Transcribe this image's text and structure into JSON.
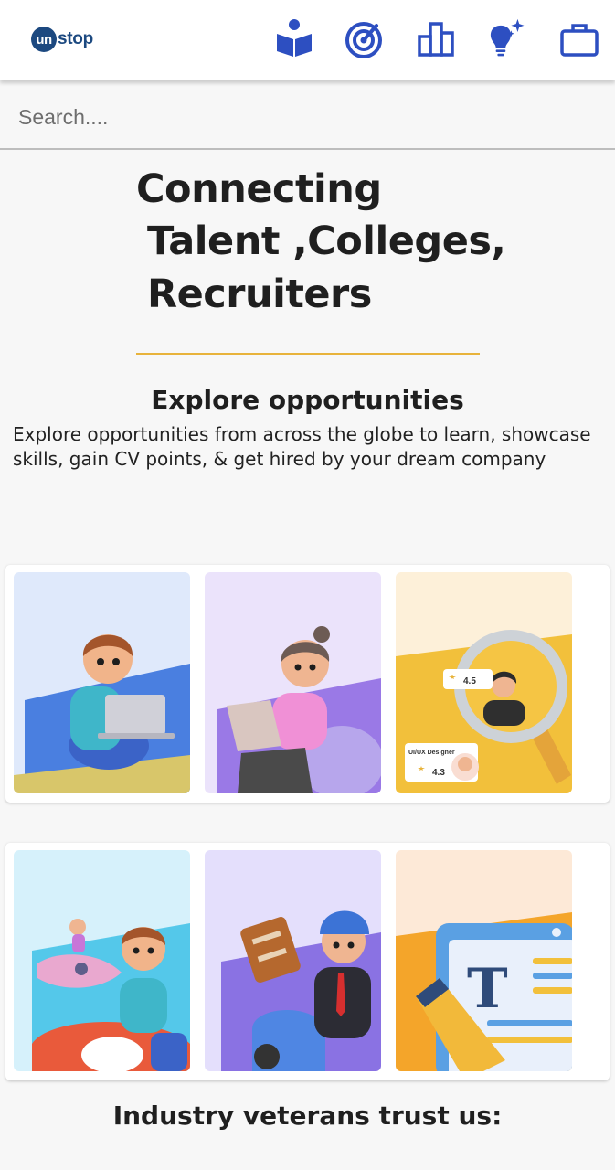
{
  "header": {
    "logo_prefix": "un",
    "logo_suffix": "stop",
    "icons": [
      "learn-book-icon",
      "practice-target-icon",
      "compete-leaderboard-icon",
      "mentorship-lightbulb-icon",
      "jobs-briefcase-icon"
    ]
  },
  "search": {
    "placeholder": "Search...."
  },
  "hero": {
    "line1": "Connecting",
    "line2": "Talent ,Colleges,",
    "line3": "Recruiters"
  },
  "explore": {
    "title": "Explore opportunities",
    "description": "Explore opportunities from across the globe to learn, showcase skills, gain CV points, & get hired by your dream company"
  },
  "cards_row1": [
    {
      "illustration": "boy-with-laptop",
      "bg": "#dfe9fb"
    },
    {
      "illustration": "girl-with-laptop",
      "bg": "#ebe3fb"
    },
    {
      "illustration": "magnifier-profile",
      "bg": "#fdf0d9",
      "rating_top": "4.5",
      "rating_bottom": "4.3",
      "tag": "UI/UX Designer"
    }
  ],
  "cards_row2": [
    {
      "illustration": "rocket-kids",
      "bg": "#d6f1fb"
    },
    {
      "illustration": "scooter-courier",
      "bg": "#e4dffc"
    },
    {
      "illustration": "document-pencil",
      "bg": "#fde9d7",
      "glyph": "T"
    }
  ],
  "footer": {
    "title": "Industry veterans trust us:"
  },
  "colors": {
    "brand": "#1c4980",
    "icon": "#2d4fc1",
    "accent_rule": "#e8b33b"
  }
}
